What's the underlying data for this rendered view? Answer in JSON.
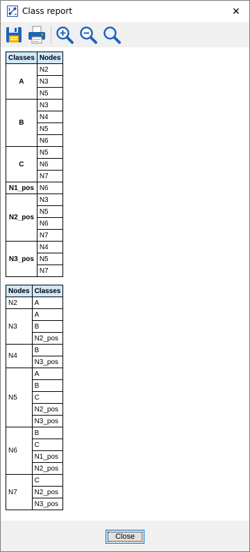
{
  "window": {
    "title": "Class report",
    "close_glyph": "✕"
  },
  "toolbar": {
    "buttons": [
      {
        "name": "save-icon"
      },
      {
        "name": "print-icon"
      },
      {
        "name": "zoom-in-icon"
      },
      {
        "name": "zoom-out-icon"
      },
      {
        "name": "zoom-reset-icon"
      }
    ]
  },
  "class_table": {
    "headers": [
      "Classes",
      "Nodes"
    ],
    "groups": [
      {
        "label": "A",
        "items": [
          "N2",
          "N3",
          "N5"
        ]
      },
      {
        "label": "B",
        "items": [
          "N3",
          "N4",
          "N5",
          "N6"
        ]
      },
      {
        "label": "C",
        "items": [
          "N5",
          "N6",
          "N7"
        ]
      },
      {
        "label": "N1_pos",
        "items": [
          "N6"
        ]
      },
      {
        "label": "N2_pos",
        "items": [
          "N3",
          "N5",
          "N6",
          "N7"
        ]
      },
      {
        "label": "N3_pos",
        "items": [
          "N4",
          "N5",
          "N7"
        ]
      }
    ]
  },
  "node_table": {
    "headers": [
      "Nodes",
      "Classes"
    ],
    "groups": [
      {
        "label": "N2",
        "items": [
          "A"
        ]
      },
      {
        "label": "N3",
        "items": [
          "A",
          "B",
          "N2_pos"
        ]
      },
      {
        "label": "N4",
        "items": [
          "B",
          "N3_pos"
        ]
      },
      {
        "label": "N5",
        "items": [
          "A",
          "B",
          "C",
          "N2_pos",
          "N3_pos"
        ]
      },
      {
        "label": "N6",
        "items": [
          "B",
          "C",
          "N1_pos",
          "N2_pos"
        ]
      },
      {
        "label": "N7",
        "items": [
          "C",
          "N2_pos",
          "N3_pos"
        ]
      }
    ]
  },
  "footer": {
    "close_label": "Close"
  },
  "colors": {
    "header_bg": "#cfe8fb",
    "toolbar_bg": "#f0f0f0",
    "accent": "#0078d7"
  }
}
